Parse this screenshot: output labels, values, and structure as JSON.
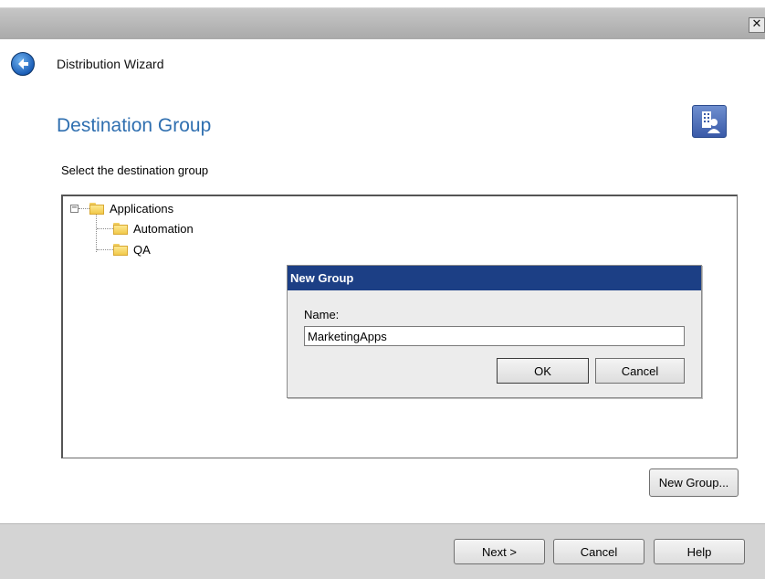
{
  "window": {
    "close_glyph": "✕"
  },
  "header": {
    "title": "Distribution Wizard",
    "back_icon": "back-arrow-icon"
  },
  "page": {
    "heading": "Destination Group",
    "heading_icon": "group-building-icon",
    "instruction": "Select the destination group"
  },
  "tree": {
    "expander_glyph": "−",
    "items": [
      {
        "label": "Applications",
        "expanded": true,
        "level": 0
      },
      {
        "label": "Automation",
        "level": 1
      },
      {
        "label": "QA",
        "level": 1
      }
    ]
  },
  "dialog": {
    "title": "New Group",
    "name_label": "Name:",
    "name_value": "MarketingApps",
    "ok_label": "OK",
    "cancel_label": "Cancel"
  },
  "actions": {
    "new_group_label": "New Group..."
  },
  "footer": {
    "next_label": "Next >",
    "cancel_label": "Cancel",
    "help_label": "Help"
  },
  "colors": {
    "heading": "#2f6fb0",
    "dialog_titlebar": "#1c3f85",
    "footer": "#d4d4d4"
  }
}
